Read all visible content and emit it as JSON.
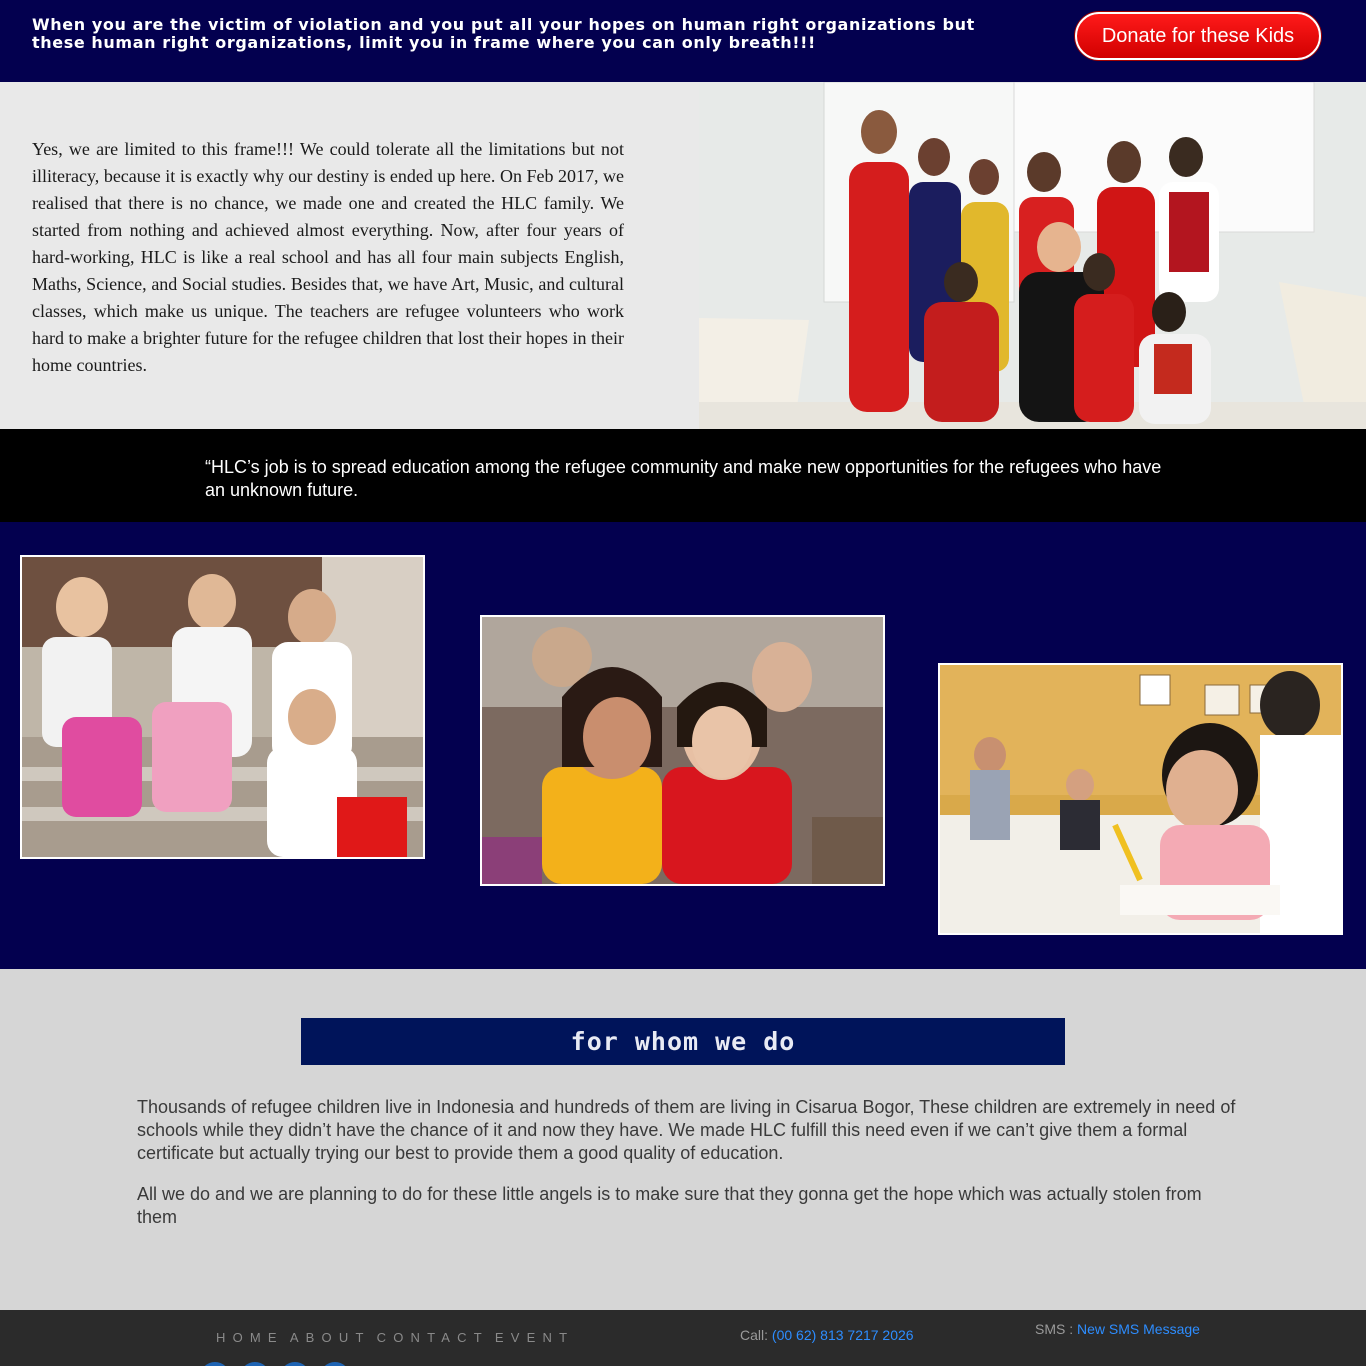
{
  "banner": {
    "text": "When you are the victim of violation and you put all your hopes on human right organizations but these human right organizations, limit you in frame where you can only breath!!!",
    "donate_label": "Donate for these Kids"
  },
  "intro": {
    "text": "Yes, we are limited to this frame!!!  We could tolerate all the limitations but not illiteracy, because it is exactly why our destiny is ended up here.   On Feb 2017, we realised that there is no chance, we made one and created the HLC family.  We started from nothing and achieved almost everything.  Now, after four years of hard-working, HLC is like a real school and has all four main subjects English, Maths, Science, and Social studies. Besides that, we have Art, Music, and cultural classes, which make us unique.  The teachers are refugee volunteers who work hard to make a brighter future for the refugee children that lost their hopes in their home countries."
  },
  "quote": {
    "text": "“HLC’s job is to spread education among the refugee community and make new opportunities for the refugees who have an unknown future."
  },
  "whom": {
    "title": "for whom we do",
    "p1": "Thousands of refugee children live in Indonesia and hundreds of them are living in Cisarua Bogor, These children are extremely in need of schools while they didn’t have the chance of it and now they have. We made HLC fulfill this need even if we can’t give them a formal certificate but actually trying our best to provide them a good quality of education.",
    "p2": "All we do and we are planning to do for these little angels is to make sure that they gonna get the hope which was actually stolen from them"
  },
  "footer": {
    "nav": [
      "HOME",
      "ABOUT",
      "CONTACT",
      "EVENT"
    ],
    "call_label": "Call: ",
    "call_number": "(00 62) 813 7217 2026",
    "sms_label": "SMS : ",
    "sms_link": "New SMS Message"
  },
  "colors": {
    "navy": "#03004f",
    "title_bar": "#00145a",
    "donate_red": "#e00000",
    "link_blue": "#2d8dff"
  }
}
